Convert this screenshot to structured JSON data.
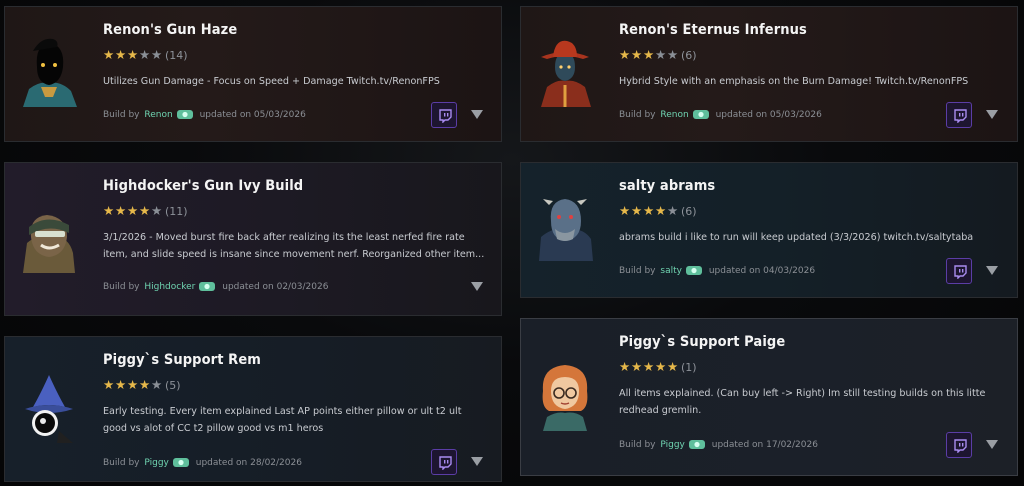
{
  "cards": [
    {
      "title": "Renon's Gun Haze",
      "stars": 3,
      "count": "(14)",
      "description": "Utilizes Gun Damage - Focus on Speed + Damage Twitch.tv/RenonFPS",
      "by": "Build by",
      "author": "Renon",
      "updated_text": "updated on 05/03/2026"
    },
    {
      "title": "Renon's Eternus Infernus",
      "stars": 3,
      "count": "(6)",
      "description": "Hybrid Style with an emphasis on the Burn Damage! Twitch.tv/RenonFPS",
      "by": "Build by",
      "author": "Renon",
      "updated_text": "updated on 05/03/2026"
    },
    {
      "title": "Highdocker's Gun Ivy Build",
      "stars": 4,
      "count": "(11)",
      "description": "3/1/2026 - Moved burst fire back after realizing its the least nerfed fire rate item, and slide speed is insane since movement nerf. Reorganized other item...",
      "by": "Build by",
      "author": "Highdocker",
      "updated_text": "updated on 02/03/2026"
    },
    {
      "title": "salty abrams",
      "stars": 4,
      "count": "(6)",
      "description": "abrams build i like to run will keep updated (3/3/2026) twitch.tv/saltytaba",
      "by": "Build by",
      "author": "salty",
      "updated_text": "updated on 04/03/2026"
    },
    {
      "title": "Piggy`s Support Rem",
      "stars": 4,
      "count": "(5)",
      "description": "Early testing. Every item explained Last AP points either pillow or ult t2 ult good vs alot of CC t2 pillow good vs m1 heros",
      "by": "Build by",
      "author": "Piggy",
      "updated_text": "updated on 28/02/2026"
    },
    {
      "title": "Piggy`s Support Paige",
      "stars": 5,
      "count": "(1)",
      "description": "All items explained. (Can buy left -> Right) Im still testing builds on this litte redhead gremlin.",
      "by": "Build by",
      "author": "Piggy",
      "updated_text": "updated on 17/02/2026"
    }
  ],
  "icons": {
    "twitch": "twitch-icon",
    "expand": "caret-down-icon",
    "badge": "verified-badge-icon",
    "star": "star-icon"
  },
  "colors": {
    "star": "#e6b84a",
    "author": "#6fd3b0",
    "twitch": "#6441a5"
  }
}
